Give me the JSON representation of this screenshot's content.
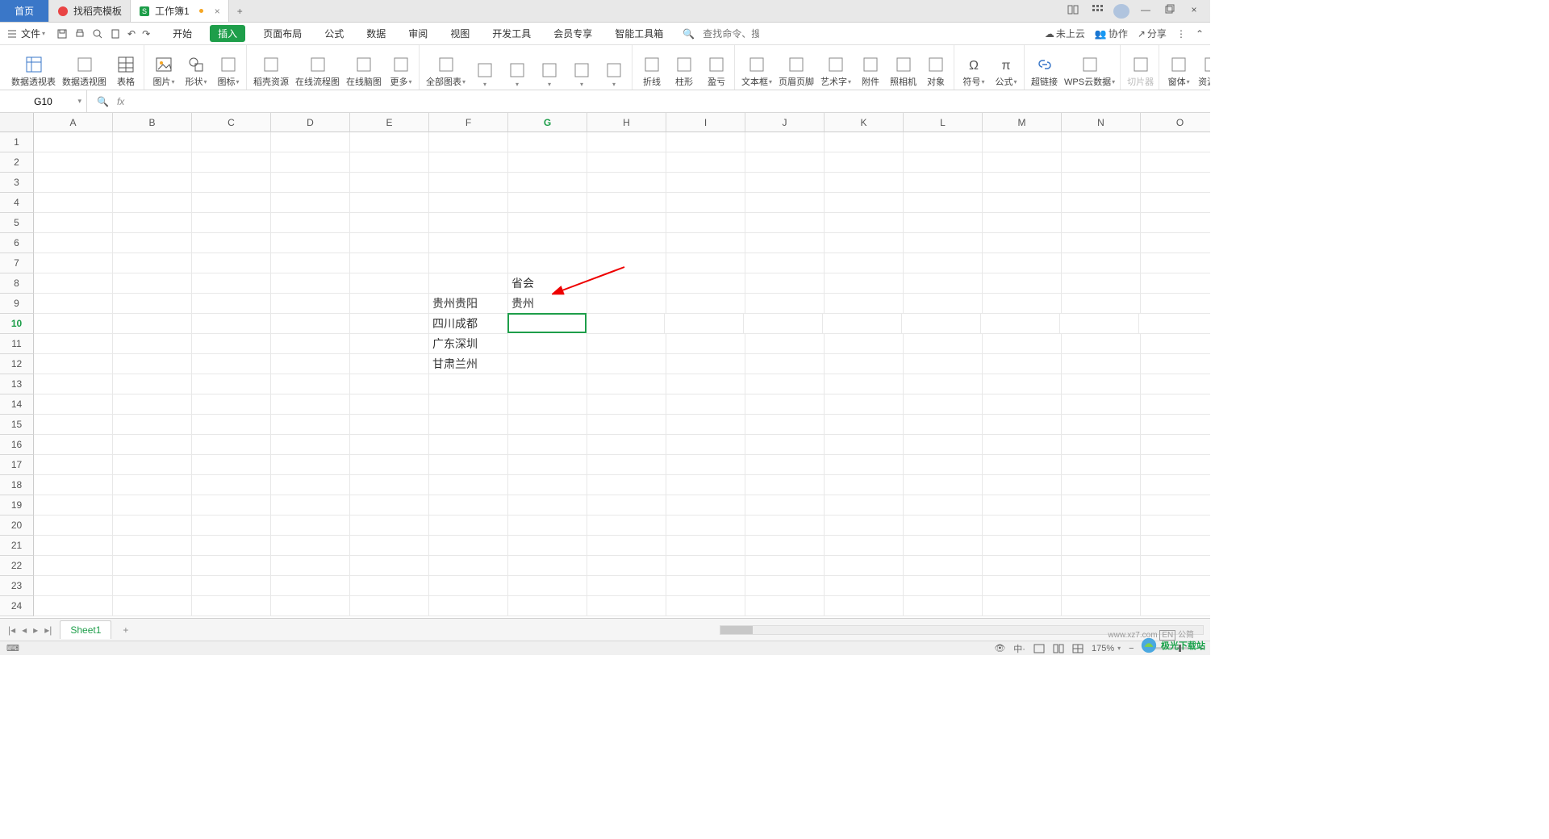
{
  "titlebar": {
    "home": "首页",
    "tab1": "找稻壳模板",
    "tab2": "工作簿1"
  },
  "menubar": {
    "file": "文件",
    "tabs": [
      "开始",
      "插入",
      "页面布局",
      "公式",
      "数据",
      "审阅",
      "视图",
      "开发工具",
      "会员专享",
      "智能工具箱"
    ],
    "active_index": 1,
    "search_ph": "查找命令、搜索模板",
    "right": {
      "cloud": "未上云",
      "collab": "协作",
      "share": "分享"
    }
  },
  "ribbon": {
    "items": [
      {
        "k": "pivot-table",
        "l": "数据透视表"
      },
      {
        "k": "pivot-chart",
        "l": "数据透视图"
      },
      {
        "k": "table",
        "l": "表格"
      },
      {
        "k": "picture",
        "l": "图片",
        "dd": true
      },
      {
        "k": "shapes",
        "l": "形状",
        "dd": true
      },
      {
        "k": "icons",
        "l": "图标",
        "dd": true
      },
      {
        "k": "docer-res",
        "l": "稻壳资源"
      },
      {
        "k": "online-flow",
        "l": "在线流程图"
      },
      {
        "k": "online-mind",
        "l": "在线脑图"
      },
      {
        "k": "more",
        "l": "更多",
        "dd": true
      },
      {
        "k": "all-charts",
        "l": "全部图表",
        "dd": true
      },
      {
        "k": "chart1",
        "l": "",
        "dd": true
      },
      {
        "k": "chart2",
        "l": "",
        "dd": true
      },
      {
        "k": "chart3",
        "l": "",
        "dd": true
      },
      {
        "k": "chart4",
        "l": "",
        "dd": true
      },
      {
        "k": "chart5",
        "l": "",
        "dd": true
      },
      {
        "k": "line-chart",
        "l": "折线"
      },
      {
        "k": "column-chart",
        "l": "柱形"
      },
      {
        "k": "win-loss",
        "l": "盈亏"
      },
      {
        "k": "text-box",
        "l": "文本框",
        "dd": true
      },
      {
        "k": "header-footer",
        "l": "页眉页脚"
      },
      {
        "k": "word-art",
        "l": "艺术字",
        "dd": true
      },
      {
        "k": "attachment",
        "l": "附件"
      },
      {
        "k": "camera",
        "l": "照相机"
      },
      {
        "k": "object",
        "l": "对象"
      },
      {
        "k": "symbol",
        "l": "符号",
        "dd": true
      },
      {
        "k": "formula",
        "l": "公式",
        "dd": true
      },
      {
        "k": "hyperlink",
        "l": "超链接"
      },
      {
        "k": "wps-cloud",
        "l": "WPS云数据",
        "dd": true
      },
      {
        "k": "slicer",
        "l": "切片器",
        "disabled": true
      },
      {
        "k": "form",
        "l": "窗体",
        "dd": true
      },
      {
        "k": "res-folder",
        "l": "资源夹"
      }
    ]
  },
  "fbar": {
    "name": "G10",
    "fx": ""
  },
  "grid": {
    "cols": [
      "A",
      "B",
      "C",
      "D",
      "E",
      "F",
      "G",
      "H",
      "I",
      "J",
      "K",
      "L",
      "M",
      "N",
      "O"
    ],
    "rows": 24,
    "active_row": 10,
    "active_col": "G",
    "data": {
      "G8": "省会",
      "F9": "贵州贵阳",
      "G9": "贵州",
      "F10": "四川成都",
      "F11": "广东深圳",
      "F12": "甘肃兰州"
    }
  },
  "sheetbar": {
    "sheet": "Sheet1"
  },
  "status": {
    "zoom": "175%",
    "ime": "EN",
    "note": "公简"
  },
  "watermark": {
    "site": "www.xz7.com",
    "brand": "极光下载站"
  }
}
